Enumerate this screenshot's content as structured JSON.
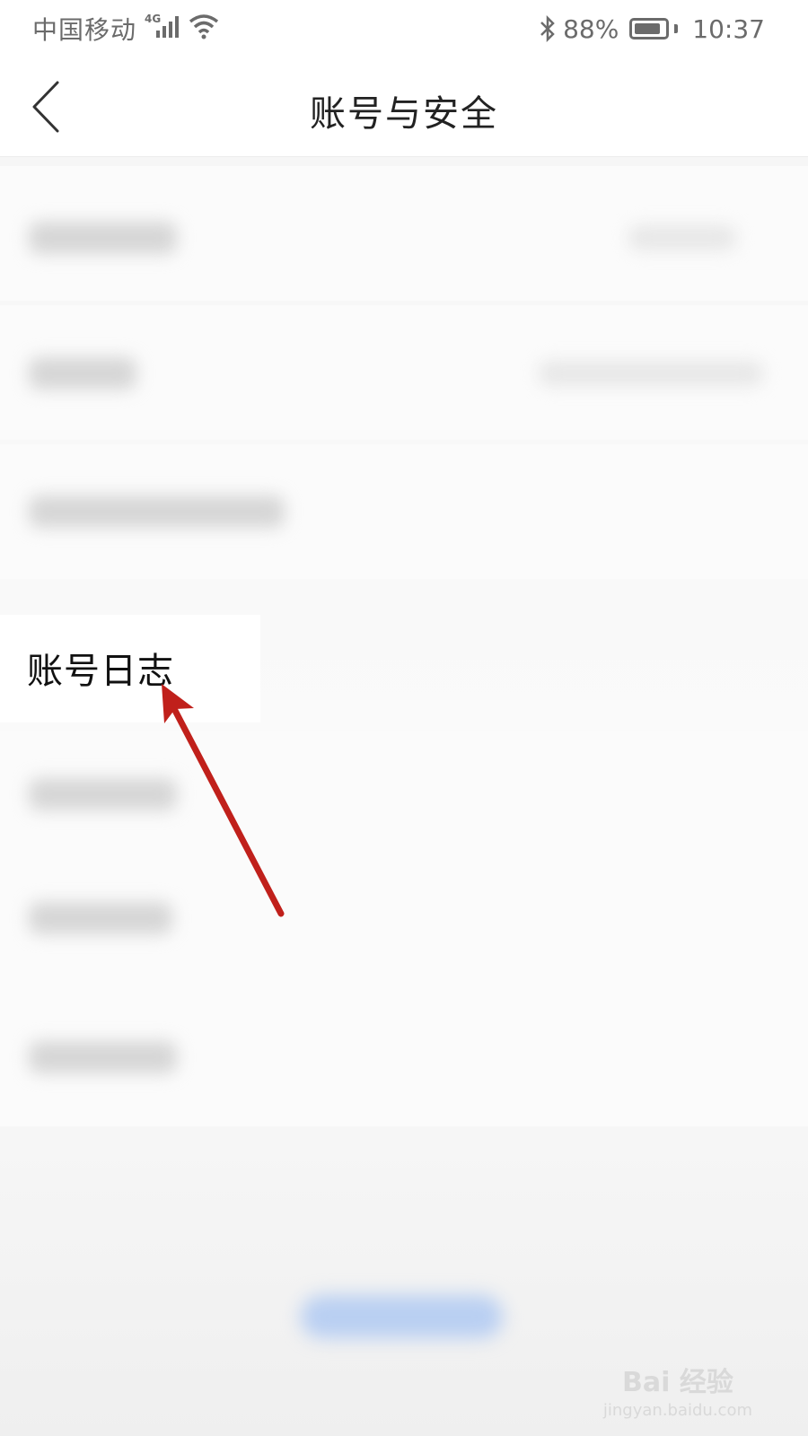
{
  "status_bar": {
    "carrier": "中国移动",
    "network_badge": "4G",
    "battery_percent_text": "88%",
    "battery_level": 0.88,
    "time": "10:37"
  },
  "nav": {
    "title": "账号与安全",
    "back_icon": "chevron-left-icon"
  },
  "list": {
    "highlighted_item_label": "账号日志"
  },
  "annotation": {
    "arrow_color": "#c0201b"
  },
  "watermark": {
    "brand": "Bai 经验",
    "url": "jingyan.baidu.com"
  },
  "colors": {
    "background": "#f6f6f6",
    "row_background": "#fbfbfb",
    "button_accent": "#b9cff2"
  }
}
